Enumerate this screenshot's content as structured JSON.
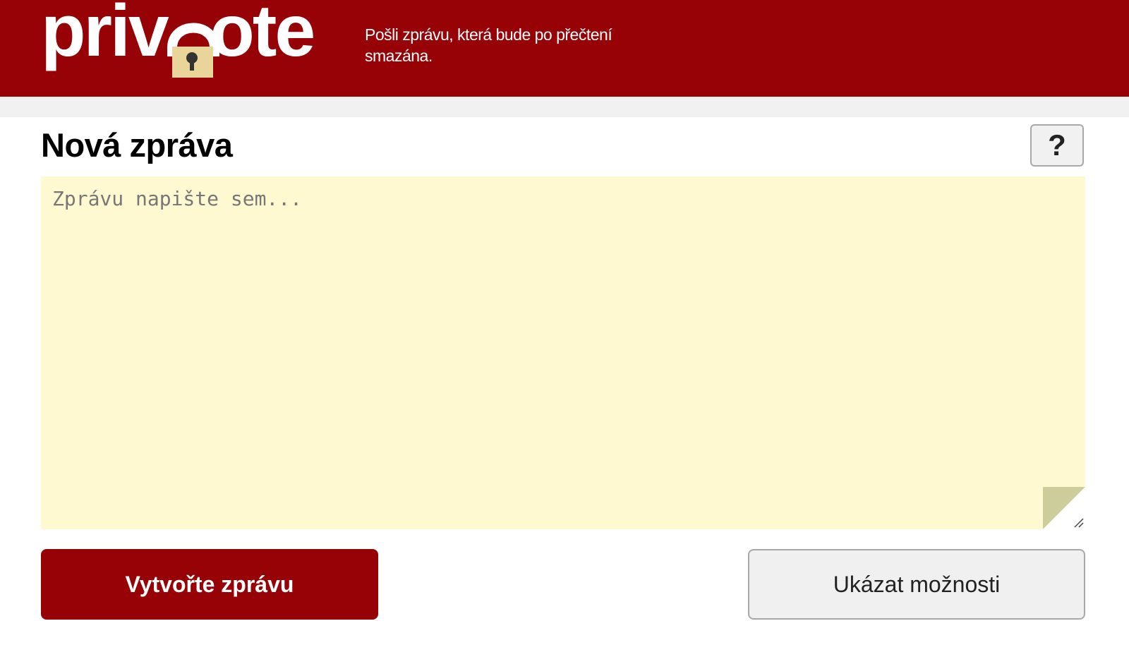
{
  "header": {
    "logo_text": "privnote",
    "tagline": "Pošli zprávu, která bude po přečtení smazána."
  },
  "main": {
    "title": "Nová zpráva",
    "help_label": "?",
    "note_placeholder": "Zprávu napište sem...",
    "note_value": ""
  },
  "actions": {
    "create_label": "Vytvořte zprávu",
    "options_label": "Ukázat možnosti"
  },
  "colors": {
    "brand": "#960205",
    "note_background": "#fef9d1",
    "lock": "#e9d49a",
    "page_curl": "#cdcc9b"
  },
  "icons": {
    "logo_lock": "padlock-icon",
    "help": "question-mark-icon",
    "resize": "resize-grip-icon"
  }
}
